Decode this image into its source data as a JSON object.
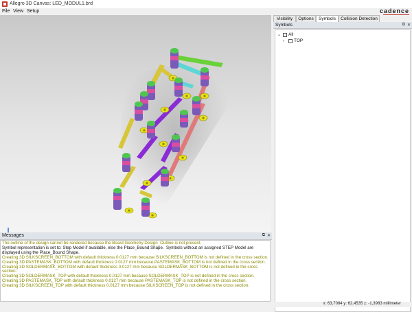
{
  "window": {
    "title": "Allegro 3D Canvas: LED_MODUL1.brd"
  },
  "menu": [
    {
      "label": "File"
    },
    {
      "label": "View"
    },
    {
      "label": "Setup"
    }
  ],
  "brand": {
    "logo_text": "cadence",
    "accent": "#c0392b"
  },
  "right_panel": {
    "tabs": [
      {
        "label": "Visibility"
      },
      {
        "label": "Options"
      },
      {
        "label": "Symbols",
        "active": true
      },
      {
        "label": "Collision Detection"
      }
    ],
    "panel_title": "Symbols",
    "tree": [
      {
        "label": "All",
        "expanded": true,
        "checked": false
      },
      {
        "label": "TOP",
        "expanded": false,
        "checked": false
      }
    ]
  },
  "messages": {
    "title": "Messages",
    "lines": [
      {
        "text": "The outline of the design cannot be rendered because the Board Geometry Design_Outline is not present.",
        "level": "warn"
      },
      {
        "text": "Symbol representation is set to: Step Model if available, else the Place_Bound Shape.  Symbols without an assigned STEP Model are displayed using the Place_Bound Shape.",
        "level": "info"
      },
      {
        "text": "Creating 3D SILKSCREEN_BOTTOM with default thickness 0.0127 mm because SILKSCREEN_BOTTOM is not defined in the cross section.",
        "level": "warn"
      },
      {
        "text": "Creating 3D PASTEMASK_BOTTOM with default thickness 0.0127 mm because PASTEMASK_BOTTOM is not defined in the cross section.",
        "level": "warn"
      },
      {
        "text": "Creating 3D SOLDERMASK_BOTTOM with default thickness 0.0127 mm because SOLDERMASK_BOTTOM is not defined in the cross section.",
        "level": "warn"
      },
      {
        "text": "Creating 3D SOLDERMASK_TOP with default thickness 0.0127 mm because SOLDERMASK_TOP is not defined in the cross section.",
        "level": "warn"
      },
      {
        "text": "Creating 3D PASTEMASK_TOP with default thickness 0.0127 mm because PASTEMASK_TOP is not defined in the cross section.",
        "level": "warn"
      },
      {
        "text": "Creating 3D SILKSCREEN_TOP with default thickness 0.0127 mm because SILKSCREEN_TOP is not defined in the cross section.",
        "level": "warn"
      }
    ]
  },
  "status": {
    "coordinates": "x: 63,7084 y: 62,4535 z: -1,3983 millimeter"
  },
  "colors": {
    "trace_yellow": "#d8c63a",
    "trace_purple": "#8a2bd6",
    "trace_red": "#e07a7a",
    "trace_cyan": "#5fd6d6",
    "trace_green": "#6ad13a",
    "pad_yellow": "#e6e21a",
    "led_green": "#4fc64f"
  }
}
